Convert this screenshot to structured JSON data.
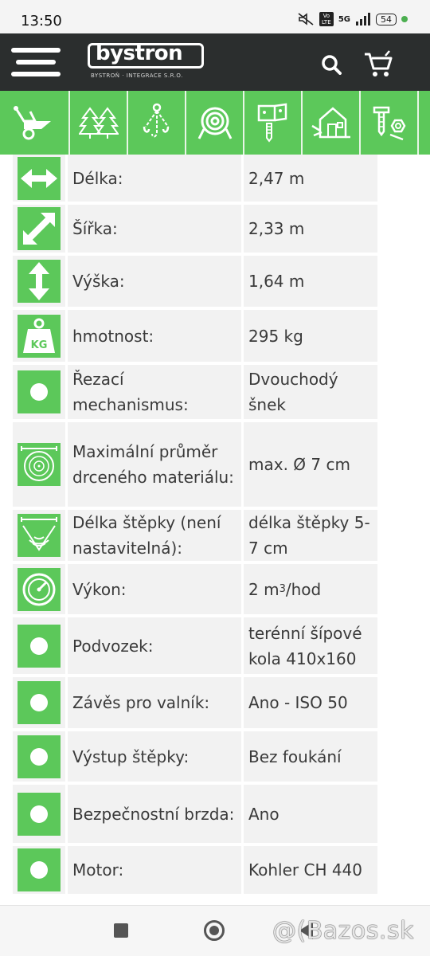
{
  "status_bar": {
    "time": "13:50",
    "network": "5G",
    "volte": "Vo LTE",
    "battery": "54"
  },
  "header": {
    "logo_text": "bystron",
    "logo_subtitle": "BYSTROŇ · INTEGRACE S.R.O.",
    "background": "#2b2e2e"
  },
  "categories": [
    {
      "icon": "wood-chipper-icon"
    },
    {
      "icon": "trees-icon"
    },
    {
      "icon": "chain-hook-icon"
    },
    {
      "icon": "rope-icon"
    },
    {
      "icon": "bracket-screw-icon"
    },
    {
      "icon": "house-tools-icon"
    },
    {
      "icon": "bolts-nuts-icon"
    }
  ],
  "accent": "#5cc85a",
  "specs": [
    {
      "icon": "length-arrows-icon",
      "label": "Délka:",
      "value": "2,47 m"
    },
    {
      "icon": "width-arrows-icon",
      "label": "Šířka:",
      "value": "2,33 m"
    },
    {
      "icon": "height-arrows-icon",
      "label": "Výška:",
      "value": "1,64 m"
    },
    {
      "icon": "weight-kg-icon",
      "label": "hmotnost:",
      "value": "295 kg",
      "icon_text": "KG"
    },
    {
      "icon": "circle-icon",
      "label": "Řezací mechanismus:",
      "value": "Dvouchodý šnek"
    },
    {
      "icon": "log-diameter-icon",
      "label": "Maximální průměr drceného materiálu:",
      "value": "max. Ø 7 cm"
    },
    {
      "icon": "chip-length-icon",
      "label": "Délka štěpky (není nastavitelná):",
      "value": "délka štěpky 5-7 cm"
    },
    {
      "icon": "gauge-icon",
      "label": "Výkon:",
      "value": "2 m",
      "value_sup": "3",
      "value_suffix": "/hod"
    },
    {
      "icon": "circle-icon",
      "label": "Podvozek:",
      "value": "terénní šípové kola 410x160"
    },
    {
      "icon": "circle-icon",
      "label": "Závěs pro valník:",
      "value": "Ano - ISO 50"
    },
    {
      "icon": "circle-icon",
      "label": "Výstup štěpky:",
      "value": "Bez foukání"
    },
    {
      "icon": "circle-icon",
      "label": "Bezpečnostní brzda:",
      "value": "Ano"
    },
    {
      "icon": "circle-icon",
      "label": "Motor:",
      "value": "Kohler CH 440"
    }
  ],
  "watermark": "@(Bazos.sk"
}
